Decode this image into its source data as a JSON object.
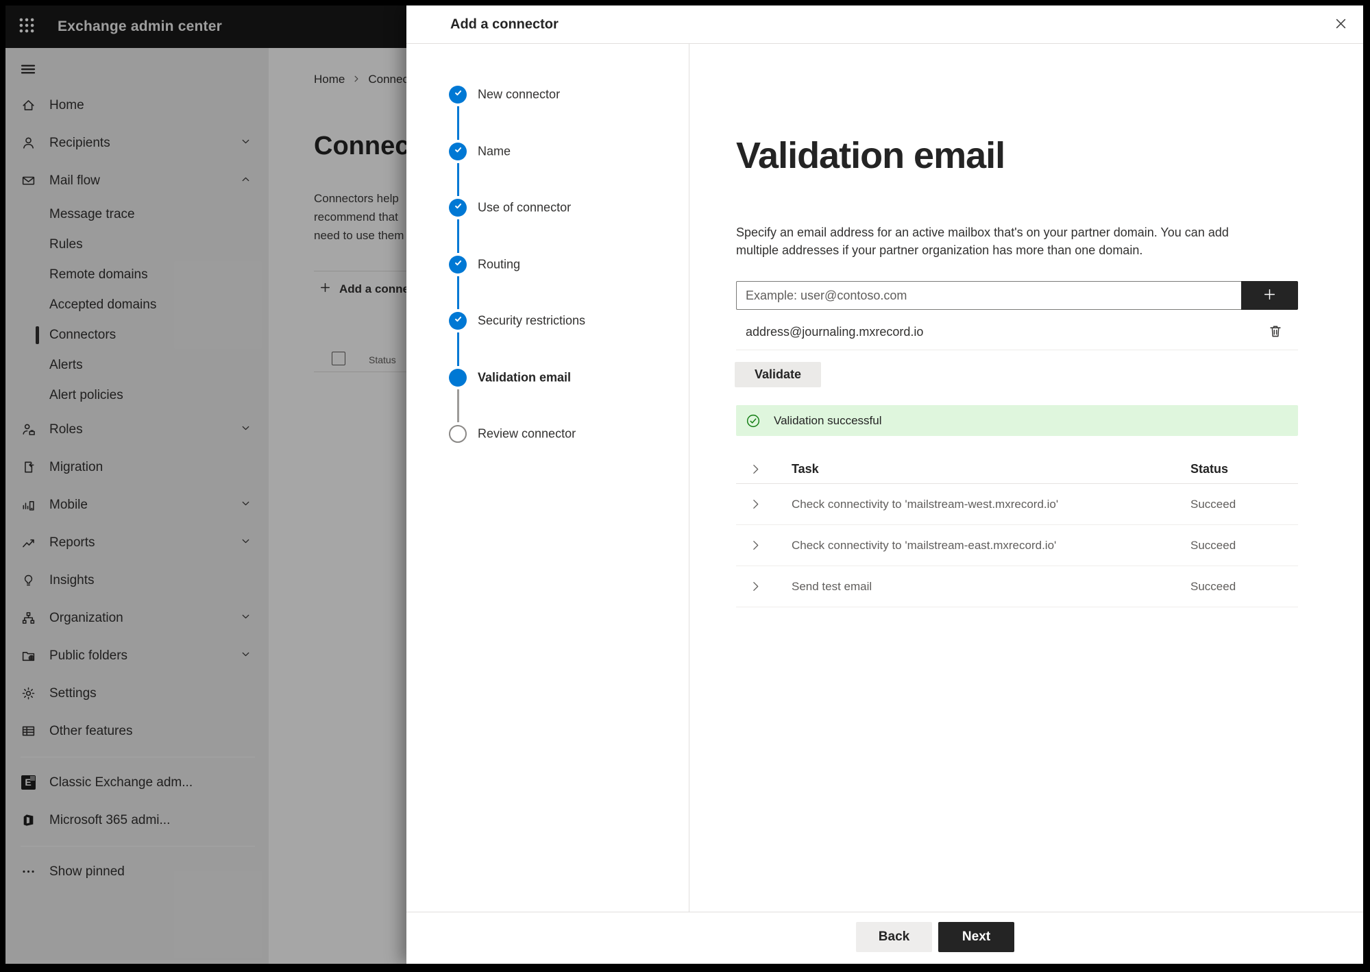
{
  "app": {
    "title": "Exchange admin center"
  },
  "colors": {
    "accent": "#0078d4",
    "success_bg": "#dff6dd",
    "success_icon": "#107c10",
    "topbar_bg": "#191919",
    "primary_button_bg": "#242424"
  },
  "sidebar": {
    "items": [
      {
        "label": "Home",
        "icon": "home"
      },
      {
        "label": "Recipients",
        "icon": "person",
        "chevron": "down"
      },
      {
        "label": "Mail flow",
        "icon": "mail",
        "chevron": "up"
      },
      {
        "label": "Message trace",
        "child": true
      },
      {
        "label": "Rules",
        "child": true
      },
      {
        "label": "Remote domains",
        "child": true
      },
      {
        "label": "Accepted domains",
        "child": true
      },
      {
        "label": "Connectors",
        "child": true,
        "selected": true
      },
      {
        "label": "Alerts",
        "child": true
      },
      {
        "label": "Alert policies",
        "child": true
      },
      {
        "label": "Roles",
        "icon": "roles",
        "chevron": "down"
      },
      {
        "label": "Migration",
        "icon": "migration"
      },
      {
        "label": "Mobile",
        "icon": "mobile",
        "chevron": "down"
      },
      {
        "label": "Reports",
        "icon": "reports",
        "chevron": "down"
      },
      {
        "label": "Insights",
        "icon": "insights"
      },
      {
        "label": "Organization",
        "icon": "organization",
        "chevron": "down"
      },
      {
        "label": "Public folders",
        "icon": "public-folders",
        "chevron": "down"
      },
      {
        "label": "Settings",
        "icon": "settings"
      },
      {
        "label": "Other features",
        "icon": "other-features"
      },
      {
        "divider": true
      },
      {
        "label": "Classic Exchange adm...",
        "icon": "exchange-logo"
      },
      {
        "label": "Microsoft 365 admi...",
        "icon": "office-logo"
      },
      {
        "divider": true
      },
      {
        "label": "Show pinned",
        "icon": "dots"
      }
    ]
  },
  "page": {
    "breadcrumb": [
      "Home",
      "Connectors"
    ],
    "title": "Connectors",
    "para": [
      "Connectors help",
      "recommend that",
      "need to use them"
    ],
    "add_button": "Add a connector",
    "status_header": "Status"
  },
  "dialog": {
    "title": "Add a connector",
    "steps": [
      {
        "label": "New connector",
        "state": "done"
      },
      {
        "label": "Name",
        "state": "done"
      },
      {
        "label": "Use of connector",
        "state": "done"
      },
      {
        "label": "Routing",
        "state": "done"
      },
      {
        "label": "Security restrictions",
        "state": "done"
      },
      {
        "label": "Validation email",
        "state": "current"
      },
      {
        "label": "Review connector",
        "state": "todo"
      }
    ],
    "heading": "Validation email",
    "desc_lines": [
      "Specify an email address for an active mailbox that's on your partner domain. You can add",
      "multiple addresses if your partner organization has more than one domain."
    ],
    "email_input": {
      "placeholder": "Example: user@contoso.com",
      "value": ""
    },
    "added_address": "address@journaling.mxrecord.io",
    "validate_button": "Validate",
    "success_message": "Validation successful",
    "table": {
      "columns": [
        "Task",
        "Status"
      ],
      "rows": [
        {
          "task": "Check connectivity to 'mailstream-west.mxrecord.io'",
          "status": "Succeed"
        },
        {
          "task": "Check connectivity to 'mailstream-east.mxrecord.io'",
          "status": "Succeed"
        },
        {
          "task": "Send test email",
          "status": "Succeed"
        }
      ]
    },
    "back_button": "Back",
    "next_button": "Next"
  }
}
